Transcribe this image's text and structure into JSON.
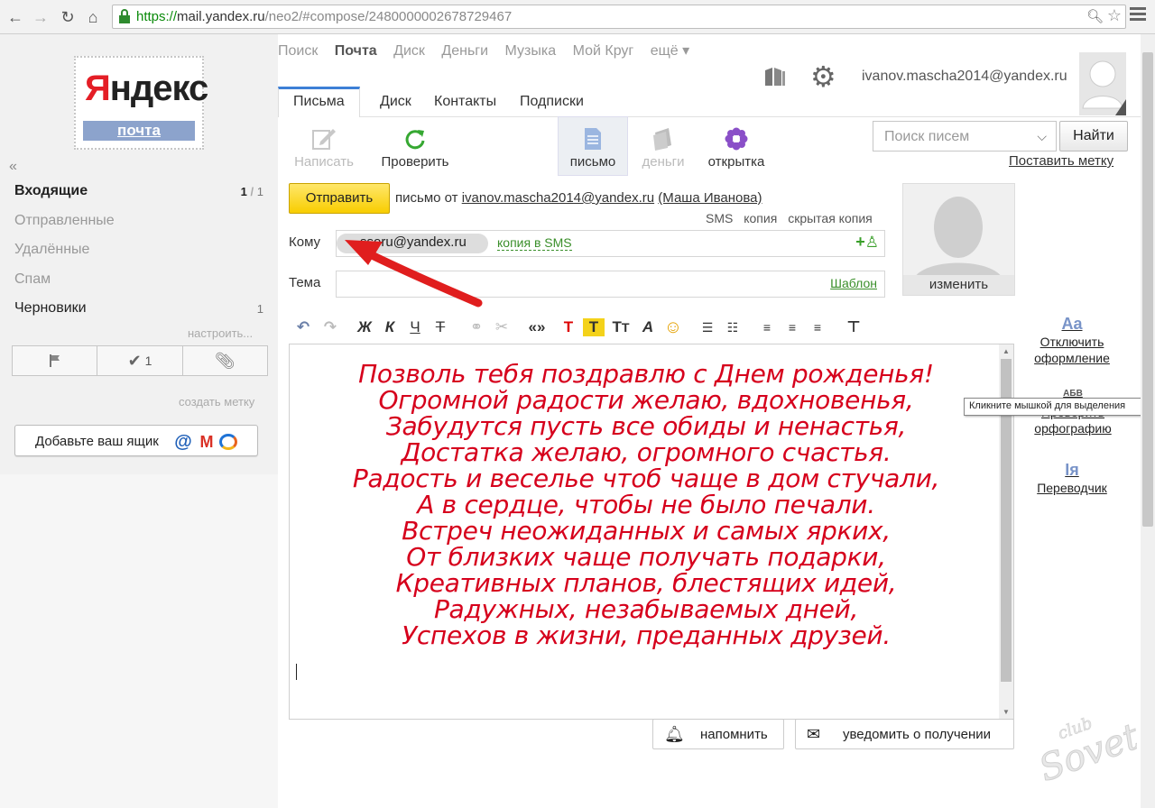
{
  "browser": {
    "url_protocol": "https://",
    "url_host": "mail.yandex.ru",
    "url_path": "/neo2/#compose/2480000002678729467"
  },
  "logo": {
    "word_y": "Я",
    "word_rest": "ндекс",
    "subtitle": "почта"
  },
  "services": [
    "Поиск",
    "Почта",
    "Диск",
    "Деньги",
    "Музыка",
    "Мой Круг",
    "ещё ▾"
  ],
  "user": {
    "email": "ivanov.mascha2014@yandex.ru"
  },
  "tabs": [
    "Письма",
    "Диск",
    "Контакты",
    "Подписки"
  ],
  "toolbar": {
    "write": "Написать",
    "check": "Проверить",
    "letter": "письмо",
    "money": "деньги",
    "postcard": "открытка"
  },
  "search": {
    "placeholder": "Поиск писем",
    "button": "Найти",
    "put_label": "Поставить метку"
  },
  "folders": [
    {
      "name": "Входящие",
      "count": "1",
      "total": "1"
    },
    {
      "name": "Отправленные"
    },
    {
      "name": "Удалённые"
    },
    {
      "name": "Спам"
    },
    {
      "name": "Черновики",
      "count": "1"
    }
  ],
  "sidebar": {
    "setup": "настроить...",
    "filter_done_count": "1",
    "create_label": "создать метку",
    "add_box": "Добавьте ваш ящик"
  },
  "compose": {
    "send": "Отправить",
    "from_prefix": "письмо от",
    "from_email": "ivanov.mascha2014@yandex.ru",
    "from_name": "(Маша Иванова)",
    "sms": "SMS",
    "copy": "копия",
    "hidden_copy": "скрытая копия",
    "to_label": "Кому",
    "to_value": "ssoru@yandex.ru",
    "to_sms_copy": "копия в SMS",
    "subject_label": "Тема",
    "template": "Шаблон",
    "photo_change": "изменить",
    "remind": "напомнить",
    "notify": "уведомить о получении"
  },
  "poem": [
    "Позволь тебя поздравлю с Днем рожденья!",
    "Огромной радости желаю, вдохновенья,",
    "Забудутся пусть все обиды и ненастья,",
    "Достатка желаю, огромного счастья.",
    "Радость и веселье чтоб чаще в дом стучали,",
    "А в сердце, чтобы не было печали.",
    "Встреч неожиданных и самых ярких,",
    "От близких чаще получать подарки,",
    "Креативных планов, блестящих идей,",
    "Радужных, незабываемых дней,",
    "Успехов в жизни, преданных друзей."
  ],
  "side_options": {
    "disable_format_1": "Отключить",
    "disable_format_2": "оформление",
    "spell_icon": "АБВ",
    "spell_1": "Проверить",
    "spell_2": "орфографию",
    "translator": "Переводчик",
    "tooltip": "Кликните мышкой для выделения"
  },
  "watermark": "club Sovet",
  "colors": {
    "accent": "#3d7fd6",
    "send": "#f8cd00",
    "poem": "#d6001c",
    "green": "#3a8f2a"
  }
}
